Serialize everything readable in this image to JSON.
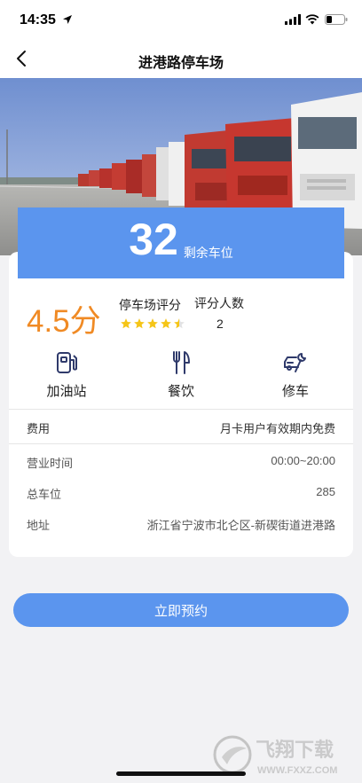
{
  "status_bar": {
    "time": "14:35"
  },
  "nav": {
    "title": "进港路停车场",
    "back_icon": "chevron-left-icon"
  },
  "spaces": {
    "count": "32",
    "label": "剩余车位"
  },
  "rating": {
    "score": "4.5分",
    "score_label": "停车场评分",
    "raters_label": "评分人数",
    "raters_count": "2",
    "stars": 4.5
  },
  "services": [
    {
      "label": "加油站",
      "icon": "fuel-pump-icon"
    },
    {
      "label": "餐饮",
      "icon": "fork-knife-icon"
    },
    {
      "label": "修车",
      "icon": "car-repair-icon"
    }
  ],
  "details": {
    "fee": {
      "label": "费用",
      "value": "月卡用户有效期内免费"
    },
    "hours": {
      "label": "营业时间",
      "value": "00:00~20:00"
    },
    "total": {
      "label": "总车位",
      "value": "285"
    },
    "address": {
      "label": "地址",
      "value": "浙江省宁波市北仑区-新碶街道进港路"
    }
  },
  "actions": {
    "reserve": "立即预约"
  },
  "watermark": {
    "text": "飞翔下载",
    "url": "WWW.FXXZ.COM"
  },
  "colors": {
    "accent": "#5b95ee",
    "score": "#f08a24",
    "star": "#f5c518"
  }
}
